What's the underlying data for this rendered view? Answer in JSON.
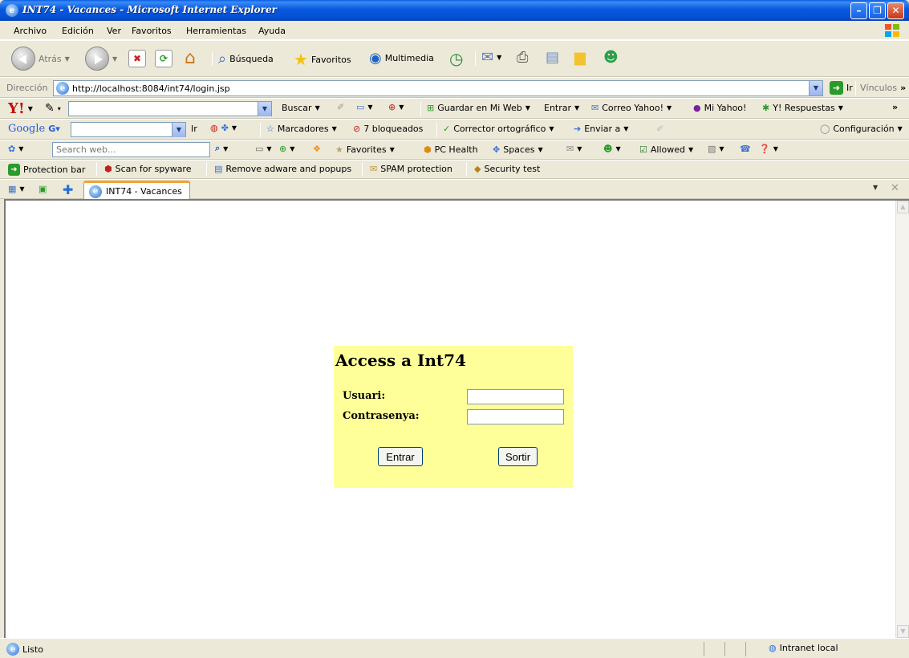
{
  "window": {
    "title": "INT74 - Vacances - Microsoft Internet Explorer"
  },
  "menu": [
    "Archivo",
    "Edición",
    "Ver",
    "Favoritos",
    "Herramientas",
    "Ayuda"
  ],
  "std_toolbar": {
    "back": "Atrás",
    "search": "Búsqueda",
    "favorites": "Favoritos",
    "multimedia": "Multimedia"
  },
  "address": {
    "label": "Dirección",
    "url": "http://localhost:8084/int74/login.jsp",
    "go": "Ir",
    "links": "Vínculos"
  },
  "yahoo": {
    "search_btn": "Buscar",
    "save": "Guardar en Mi Web",
    "enter": "Entrar",
    "mail": "Correo Yahoo!",
    "my": "Mi Yahoo!",
    "answers": "Y! Respuestas"
  },
  "google": {
    "logo": "Google",
    "go": "Ir",
    "bookmarks": "Marcadores",
    "blocked": "7 bloqueados",
    "spell": "Corrector ortográfico",
    "send": "Enviar a",
    "settings": "Configuración"
  },
  "msn": {
    "search_placeholder": "Search web...",
    "favorites": "Favorites",
    "pc_health": "PC Health",
    "spaces": "Spaces",
    "allowed": "Allowed"
  },
  "protection": [
    "Protection bar",
    "Scan for spyware",
    "Remove adware and popups",
    "SPAM protection",
    "Security test"
  ],
  "tab": {
    "label": "INT74 - Vacances"
  },
  "login": {
    "title": "Access a Int74",
    "user_label": "Usuari:",
    "password_label": "Contrasenya:",
    "user_value": "",
    "password_value": "",
    "submit": "Entrar",
    "exit": "Sortir"
  },
  "status": {
    "text": "Listo",
    "zone": "Intranet local"
  }
}
